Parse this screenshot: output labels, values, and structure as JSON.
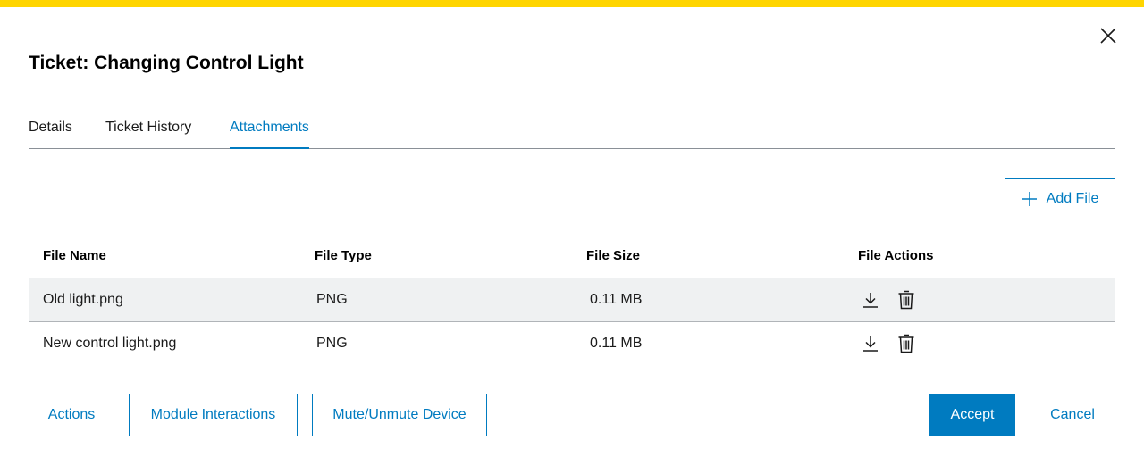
{
  "colors": {
    "top_bar": "#ffd500",
    "accent": "#007bc0",
    "row_shaded": "#eff1f2"
  },
  "dialog": {
    "title": "Ticket: Changing Control Light",
    "close_icon": "close-icon"
  },
  "tabs": [
    {
      "label": "Details",
      "active": false
    },
    {
      "label": "Ticket History",
      "active": false
    },
    {
      "label": "Attachments",
      "active": true
    }
  ],
  "attachments": {
    "add_file_label": "Add File",
    "add_file_icon": "plus-icon",
    "columns": [
      "File Name",
      "File Type",
      "File Size",
      "File Actions"
    ],
    "rows": [
      {
        "name": "Old light.png",
        "type": "PNG",
        "size": "0.11 MB",
        "actions": [
          "download-icon",
          "trash-icon"
        ]
      },
      {
        "name": "New control light.png",
        "type": "PNG",
        "size": "0.11 MB",
        "actions": [
          "download-icon",
          "trash-icon"
        ]
      }
    ]
  },
  "footer": {
    "actions_label": "Actions",
    "module_interactions_label": "Module Interactions",
    "mute_unmute_label": "Mute/Unmute Device",
    "accept_label": "Accept",
    "cancel_label": "Cancel"
  }
}
